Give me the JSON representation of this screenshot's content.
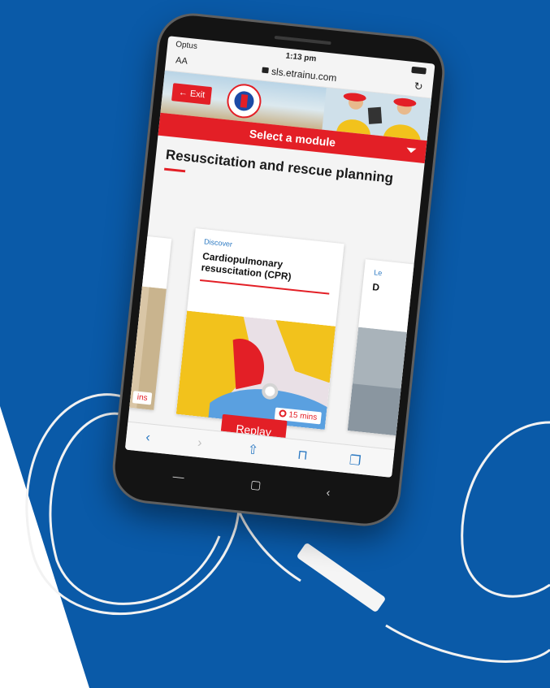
{
  "status": {
    "carrier": "Optus",
    "time": "1:13 pm"
  },
  "browser": {
    "text_size_label": "AA",
    "url": "sls.etrainu.com"
  },
  "banner": {
    "exit_label": "← Exit"
  },
  "module_selector": {
    "label": "Select a module"
  },
  "page": {
    "title": "Resuscitation and rescue planning"
  },
  "cards": {
    "center": {
      "category": "Discover",
      "title": "Cardiopulmonary resuscitation (CPR)",
      "duration": "15 mins"
    },
    "left": {
      "duration": "ins"
    },
    "right": {
      "category": "Le",
      "title": "D"
    }
  },
  "actions": {
    "replay_label": "Replay"
  },
  "colors": {
    "brand_blue": "#0a5aa8",
    "brand_red": "#e31f26",
    "link_blue": "#2a78c2"
  },
  "icons": {
    "toolbar": [
      "back-icon",
      "forward-icon",
      "share-icon",
      "bookmarks-icon",
      "tabs-icon"
    ],
    "android": [
      "recents-icon",
      "home-icon",
      "back-icon"
    ]
  }
}
